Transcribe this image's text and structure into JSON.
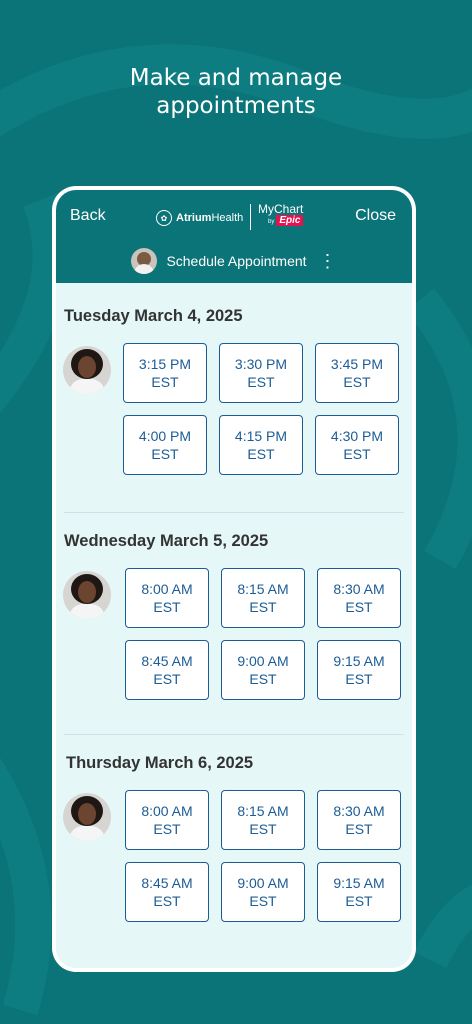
{
  "headline": {
    "line1": "Make and manage",
    "line2": "appointments"
  },
  "header": {
    "back_label": "Back",
    "close_label": "Close",
    "brand_atrium_bold": "Atrium",
    "brand_atrium_light": "Health",
    "brand_mychart": "MyChart",
    "brand_by": "by",
    "brand_epic": "Epic",
    "title": "Schedule Appointment"
  },
  "days": [
    {
      "title": "Tuesday March 4, 2025",
      "slots": [
        {
          "time": "3:15 PM",
          "tz": "EST"
        },
        {
          "time": "3:30 PM",
          "tz": "EST"
        },
        {
          "time": "3:45 PM",
          "tz": "EST"
        },
        {
          "time": "4:00 PM",
          "tz": "EST"
        },
        {
          "time": "4:15 PM",
          "tz": "EST"
        },
        {
          "time": "4:30 PM",
          "tz": "EST"
        }
      ]
    },
    {
      "title": "Wednesday March 5, 2025",
      "slots": [
        {
          "time": "8:00 AM",
          "tz": "EST"
        },
        {
          "time": "8:15 AM",
          "tz": "EST"
        },
        {
          "time": "8:30 AM",
          "tz": "EST"
        },
        {
          "time": "8:45 AM",
          "tz": "EST"
        },
        {
          "time": "9:00 AM",
          "tz": "EST"
        },
        {
          "time": "9:15 AM",
          "tz": "EST"
        }
      ]
    },
    {
      "title": "Thursday March 6, 2025",
      "slots": [
        {
          "time": "8:00 AM",
          "tz": "EST"
        },
        {
          "time": "8:15 AM",
          "tz": "EST"
        },
        {
          "time": "8:30 AM",
          "tz": "EST"
        },
        {
          "time": "8:45 AM",
          "tz": "EST"
        },
        {
          "time": "9:00 AM",
          "tz": "EST"
        },
        {
          "time": "9:15 AM",
          "tz": "EST"
        }
      ]
    }
  ],
  "colors": {
    "background": "#0b7478",
    "accent": "#1c5c96",
    "content_bg": "#e6f7f8"
  }
}
